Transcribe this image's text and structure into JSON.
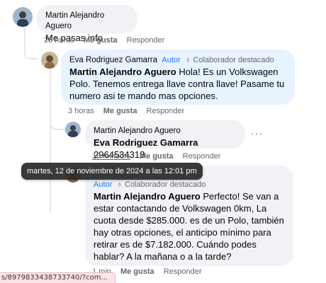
{
  "comments": [
    {
      "author": "Martin Alejandro Aguero",
      "text": "Me pasas info",
      "time": "23 horas",
      "like": "Me gusta",
      "reply": "Responder"
    },
    {
      "author": "Eva Rodriguez Gamarra",
      "author_badge": "Autor",
      "contributor_badge": "Colaborador destacado",
      "mention": "Martin Alejandro Aguero",
      "text": " Hola! Es un Volkswagen Polo. Tenemos entrega llave contra llave! Pasame tu numero asi te mando mas opciones.",
      "time": "3 horas",
      "like": "Me gusta",
      "reply": "Responder"
    },
    {
      "author": "Martin Alejandro Aguero",
      "mention": "Eva Rodriguez Gamarra",
      "text": " 2964534313",
      "time": "16 minutos",
      "like": "Me gusta",
      "reply": "Responder",
      "more": "···"
    },
    {
      "author_badge": "Autor",
      "contributor_badge": "Colaborador destacado",
      "mention": "Martin Alejandro Aguero",
      "text": " Perfecto! Se van a estar contactando de Volkswagen 0km, La cuota desde $285.000. es de un Polo, también hay otras opciones, el anticipo mínimo para retirar es de $7.182.000. Cuándo podes hablar? A la mañana o a la tarde?",
      "time": "1 min",
      "like": "Me gusta",
      "reply": "Responder"
    }
  ],
  "tooltip": "martes, 12 de noviembre de 2024 a las 12:01 pm",
  "status_url": "s/8979833438733740/?com..."
}
